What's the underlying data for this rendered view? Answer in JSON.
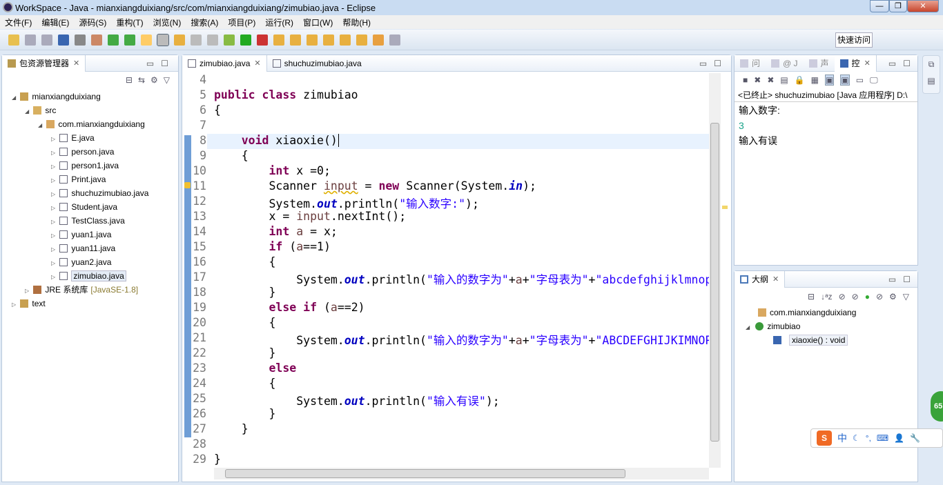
{
  "window": {
    "title": "WorkSpace - Java - mianxiangduixiang/src/com/mianxiangduixiang/zimubiao.java - Eclipse"
  },
  "menu": [
    "文件(F)",
    "编辑(E)",
    "源码(S)",
    "重构(T)",
    "浏览(N)",
    "搜索(A)",
    "项目(P)",
    "运行(R)",
    "窗口(W)",
    "帮助(H)"
  ],
  "quick_access": "快速访问",
  "package_explorer": {
    "title": "包资源管理器",
    "items": [
      {
        "label": "mianxiangduixiang",
        "level": 0,
        "icon": "project-icon"
      },
      {
        "label": "src",
        "level": 1,
        "icon": "source-folder-icon"
      },
      {
        "label": "com.mianxiangduixiang",
        "level": 2,
        "icon": "package-icon"
      },
      {
        "label": "E.java",
        "level": 3,
        "icon": "java-file-icon"
      },
      {
        "label": "person.java",
        "level": 3,
        "icon": "java-file-icon"
      },
      {
        "label": "person1.java",
        "level": 3,
        "icon": "java-file-icon"
      },
      {
        "label": "Print.java",
        "level": 3,
        "icon": "java-file-icon"
      },
      {
        "label": "shuchuzimubiao.java",
        "level": 3,
        "icon": "java-file-icon"
      },
      {
        "label": "Student.java",
        "level": 3,
        "icon": "java-file-icon"
      },
      {
        "label": "TestClass.java",
        "level": 3,
        "icon": "java-file-icon"
      },
      {
        "label": "yuan1.java",
        "level": 3,
        "icon": "java-file-icon"
      },
      {
        "label": "yuan11.java",
        "level": 3,
        "icon": "java-file-icon"
      },
      {
        "label": "yuan2.java",
        "level": 3,
        "icon": "java-file-icon"
      },
      {
        "label": "zimubiao.java",
        "level": 3,
        "icon": "java-file-icon",
        "selected": true
      },
      {
        "label": "JRE 系统库",
        "suffix": "[JavaSE-1.8]",
        "level": 1,
        "icon": "library-icon"
      },
      {
        "label": "text",
        "level": 0,
        "icon": "project-icon"
      }
    ]
  },
  "editor": {
    "tabs": [
      {
        "label": "zimubiao.java",
        "active": true
      },
      {
        "label": "shuchuzimubiao.java",
        "active": false
      }
    ],
    "lines": [
      {
        "n": "4",
        "t": []
      },
      {
        "n": "5",
        "t": [
          [
            "public class ",
            "kw"
          ],
          [
            "zimubiao",
            ""
          ]
        ]
      },
      {
        "n": "6",
        "t": [
          [
            "{",
            ""
          ]
        ]
      },
      {
        "n": "7",
        "t": []
      },
      {
        "n": "8",
        "t": [
          [
            "    void ",
            "kw"
          ],
          [
            "xiaoxie()",
            ""
          ]
        ],
        "current": true
      },
      {
        "n": "9",
        "t": [
          [
            "    {",
            ""
          ]
        ]
      },
      {
        "n": "10",
        "t": [
          [
            "        int ",
            "kw"
          ],
          [
            "x =0;",
            ""
          ]
        ]
      },
      {
        "n": "11",
        "t": [
          [
            "        Scanner ",
            ""
          ],
          [
            "input",
            "lv warn"
          ],
          [
            " = ",
            ""
          ],
          [
            "new ",
            "kw"
          ],
          [
            "Scanner(System.",
            ""
          ],
          [
            "in",
            "fl"
          ],
          [
            ");",
            ""
          ]
        ]
      },
      {
        "n": "12",
        "t": [
          [
            "        System.",
            ""
          ],
          [
            "out",
            "fl"
          ],
          [
            ".println(",
            ""
          ],
          [
            "\"输入数字:\"",
            "st"
          ],
          [
            ");",
            ""
          ]
        ]
      },
      {
        "n": "13",
        "t": [
          [
            "        x = ",
            ""
          ],
          [
            "input",
            "lv"
          ],
          [
            ".nextInt();",
            ""
          ]
        ]
      },
      {
        "n": "14",
        "t": [
          [
            "        int ",
            "kw"
          ],
          [
            "a",
            "lv"
          ],
          [
            " = x;",
            ""
          ]
        ]
      },
      {
        "n": "15",
        "t": [
          [
            "        if ",
            "kw"
          ],
          [
            "(",
            ""
          ],
          [
            "a",
            "lv"
          ],
          [
            "==1)",
            ""
          ]
        ]
      },
      {
        "n": "16",
        "t": [
          [
            "        {",
            ""
          ]
        ]
      },
      {
        "n": "17",
        "t": [
          [
            "            System.",
            ""
          ],
          [
            "out",
            "fl"
          ],
          [
            ".println(",
            ""
          ],
          [
            "\"输入的数字为\"",
            "st"
          ],
          [
            "+",
            ""
          ],
          [
            "a",
            "lv"
          ],
          [
            "+",
            ""
          ],
          [
            "\"字母表为\"",
            "st"
          ],
          [
            "+",
            ""
          ],
          [
            "\"abcdefghijklmnopqrstuvwxyz\"",
            "st"
          ]
        ]
      },
      {
        "n": "18",
        "t": [
          [
            "        }",
            ""
          ]
        ]
      },
      {
        "n": "19",
        "t": [
          [
            "        else if ",
            "kw"
          ],
          [
            "(",
            ""
          ],
          [
            "a",
            "lv"
          ],
          [
            "==2)",
            ""
          ]
        ]
      },
      {
        "n": "20",
        "t": [
          [
            "        {",
            ""
          ]
        ]
      },
      {
        "n": "21",
        "t": [
          [
            "            System.",
            ""
          ],
          [
            "out",
            "fl"
          ],
          [
            ".println(",
            ""
          ],
          [
            "\"输入的数字为\"",
            "st"
          ],
          [
            "+",
            ""
          ],
          [
            "a",
            "lv"
          ],
          [
            "+",
            ""
          ],
          [
            "\"字母表为\"",
            "st"
          ],
          [
            "+",
            ""
          ],
          [
            "\"ABCDEFGHIJKIMNOPQRSTUVWXYZ\"",
            "st"
          ]
        ]
      },
      {
        "n": "22",
        "t": [
          [
            "        }",
            ""
          ]
        ]
      },
      {
        "n": "23",
        "t": [
          [
            "        else",
            "kw"
          ]
        ]
      },
      {
        "n": "24",
        "t": [
          [
            "        {",
            ""
          ]
        ]
      },
      {
        "n": "25",
        "t": [
          [
            "            System.",
            ""
          ],
          [
            "out",
            "fl"
          ],
          [
            ".println(",
            ""
          ],
          [
            "\"输入有误\"",
            "st"
          ],
          [
            ");",
            ""
          ]
        ]
      },
      {
        "n": "26",
        "t": [
          [
            "        }",
            ""
          ]
        ]
      },
      {
        "n": "27",
        "t": [
          [
            "    }",
            ""
          ]
        ]
      },
      {
        "n": "28",
        "t": []
      },
      {
        "n": "29",
        "t": [
          [
            "}",
            ""
          ]
        ]
      }
    ]
  },
  "console": {
    "tabs": [
      "问",
      "@ J",
      "声",
      "控"
    ],
    "status": "<已终止> shuchuzimubiao [Java 应用程序] D:\\",
    "output": [
      {
        "text": "输入数字:",
        "input": false
      },
      {
        "text": "3",
        "input": true
      },
      {
        "text": "输入有误",
        "input": false
      }
    ]
  },
  "outline": {
    "title": "大纲",
    "items": [
      {
        "label": "com.mianxiangduixiang",
        "icon": "package-icon"
      },
      {
        "label": "zimubiao",
        "icon": "class-icon"
      },
      {
        "label": "xiaoxie() : void",
        "icon": "method-icon"
      }
    ]
  },
  "ime": {
    "label": "中"
  },
  "badge": "65",
  "colors": {
    "keyword": "#7f0055",
    "string": "#2a00ff",
    "field": "#0000c0",
    "input": "#1aa38a"
  }
}
